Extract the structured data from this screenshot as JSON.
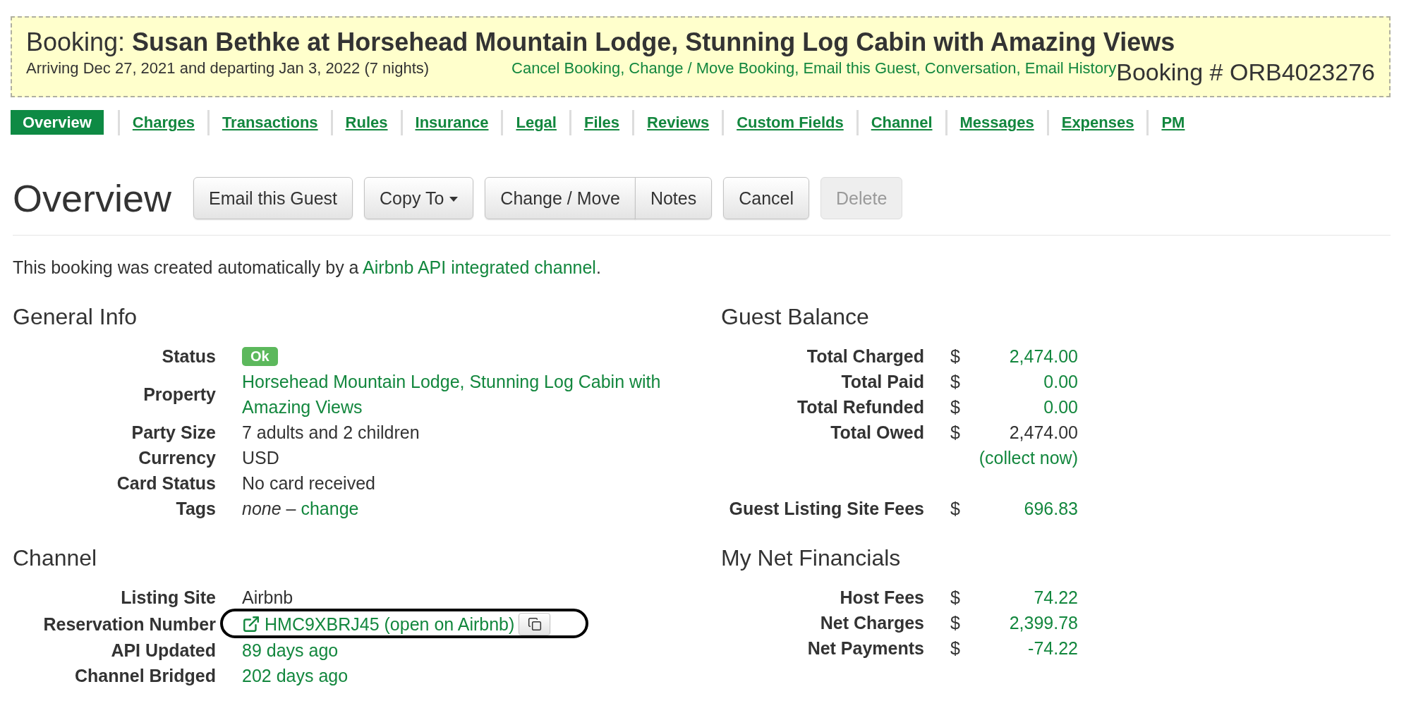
{
  "header": {
    "title": "Booking: **Susan Bethke at Horsehead Mountain Lodge, Stunning Log Cabin with Amazing Views**",
    "dates": "Arriving Dec 27, 2021 and departing Jan 3, 2022 (7 nights)",
    "link_separator": ",",
    "links": [
      "Cancel Booking",
      "Change / Move Booking",
      "Email this Guest",
      "Conversation",
      "Email History"
    ],
    "booking_number": "Booking # ORB4023276"
  },
  "tabs": [
    {
      "label": "Overview",
      "selected": true
    },
    {
      "label": "Charges",
      "selected": false
    },
    {
      "label": "Transactions",
      "selected": false
    },
    {
      "label": "Rules",
      "selected": false
    },
    {
      "label": "Insurance",
      "selected": false
    },
    {
      "label": "Legal",
      "selected": false
    },
    {
      "label": "Files",
      "selected": false
    },
    {
      "label": "Reviews",
      "selected": false
    },
    {
      "label": "Custom Fields",
      "selected": false
    },
    {
      "label": "Channel",
      "selected": false
    },
    {
      "label": "Messages",
      "selected": false
    },
    {
      "label": "Expenses",
      "selected": false
    },
    {
      "label": "PM",
      "selected": false
    }
  ],
  "page": {
    "title": "Overview",
    "toolbar": [
      {
        "kind": "button",
        "label": "Email this Guest",
        "disabled": false
      },
      {
        "kind": "dropdown",
        "label": "Copy To",
        "disabled": false
      },
      {
        "kind": "group",
        "buttons": [
          {
            "label": "Change / Move",
            "disabled": false
          },
          {
            "label": "Notes",
            "disabled": false
          }
        ]
      },
      {
        "kind": "button",
        "label": "Cancel",
        "disabled": false
      },
      {
        "kind": "button",
        "label": "Delete",
        "disabled": true
      }
    ]
  },
  "notice": {
    "text": "This booking was created automatically by a",
    "link": "Airbnb API integrated channel",
    "end": "."
  },
  "general_info": {
    "title": "General Info",
    "rows": [
      {
        "label": "Status",
        "kind": "badge",
        "value": "Ok",
        "color": "#5cb85c"
      },
      {
        "label": "Property",
        "kind": "link",
        "value": "Horsehead Mountain Lodge, Stunning Log Cabin with Amazing Views"
      },
      {
        "label": "Party Size",
        "kind": "text",
        "value": "7 adults and 2 children"
      },
      {
        "label": "Currency",
        "kind": "text",
        "value": "USD"
      },
      {
        "label": "Card Status",
        "kind": "text",
        "value": "No card received"
      },
      {
        "label": "Tags",
        "kind": "tags",
        "value": "none",
        "separator": "–",
        "link": "change"
      }
    ]
  },
  "channel": {
    "title": "Channel",
    "rows": [
      {
        "label": "Listing Site",
        "kind": "text",
        "value": "Airbnb"
      },
      {
        "label": "Reservation Number",
        "kind": "reservation",
        "value": "HMC9XBRJ45 (open on Airbnb)"
      },
      {
        "label": "API Updated",
        "kind": "link",
        "value": "89 days ago"
      },
      {
        "label": "Channel Bridged",
        "kind": "link",
        "value": "202 days ago"
      }
    ]
  },
  "guest_balance": {
    "title": "Guest Balance",
    "rows": [
      {
        "label": "Total Charged",
        "currency": "$",
        "value": "2,474.00",
        "kind": "link"
      },
      {
        "label": "Total Paid",
        "currency": "$",
        "value": "0.00",
        "kind": "link"
      },
      {
        "label": "Total Refunded",
        "currency": "$",
        "value": "0.00",
        "kind": "link"
      },
      {
        "label": "Total Owed",
        "currency": "$",
        "value": "2,474.00",
        "kind": "text"
      },
      {
        "kind": "action",
        "value": "(collect now)"
      }
    ],
    "fees": [
      {
        "label": "Guest Listing Site Fees",
        "currency": "$",
        "value": "696.83",
        "kind": "link"
      }
    ]
  },
  "net_financials": {
    "title": "My Net Financials",
    "rows": [
      {
        "label": "Host Fees",
        "currency": "$",
        "value": "74.22",
        "kind": "link"
      },
      {
        "label": "Net Charges",
        "currency": "$",
        "value": "2,399.78",
        "kind": "link"
      },
      {
        "label": "Net Payments",
        "currency": "$",
        "value": "-74.22",
        "kind": "link"
      }
    ]
  }
}
